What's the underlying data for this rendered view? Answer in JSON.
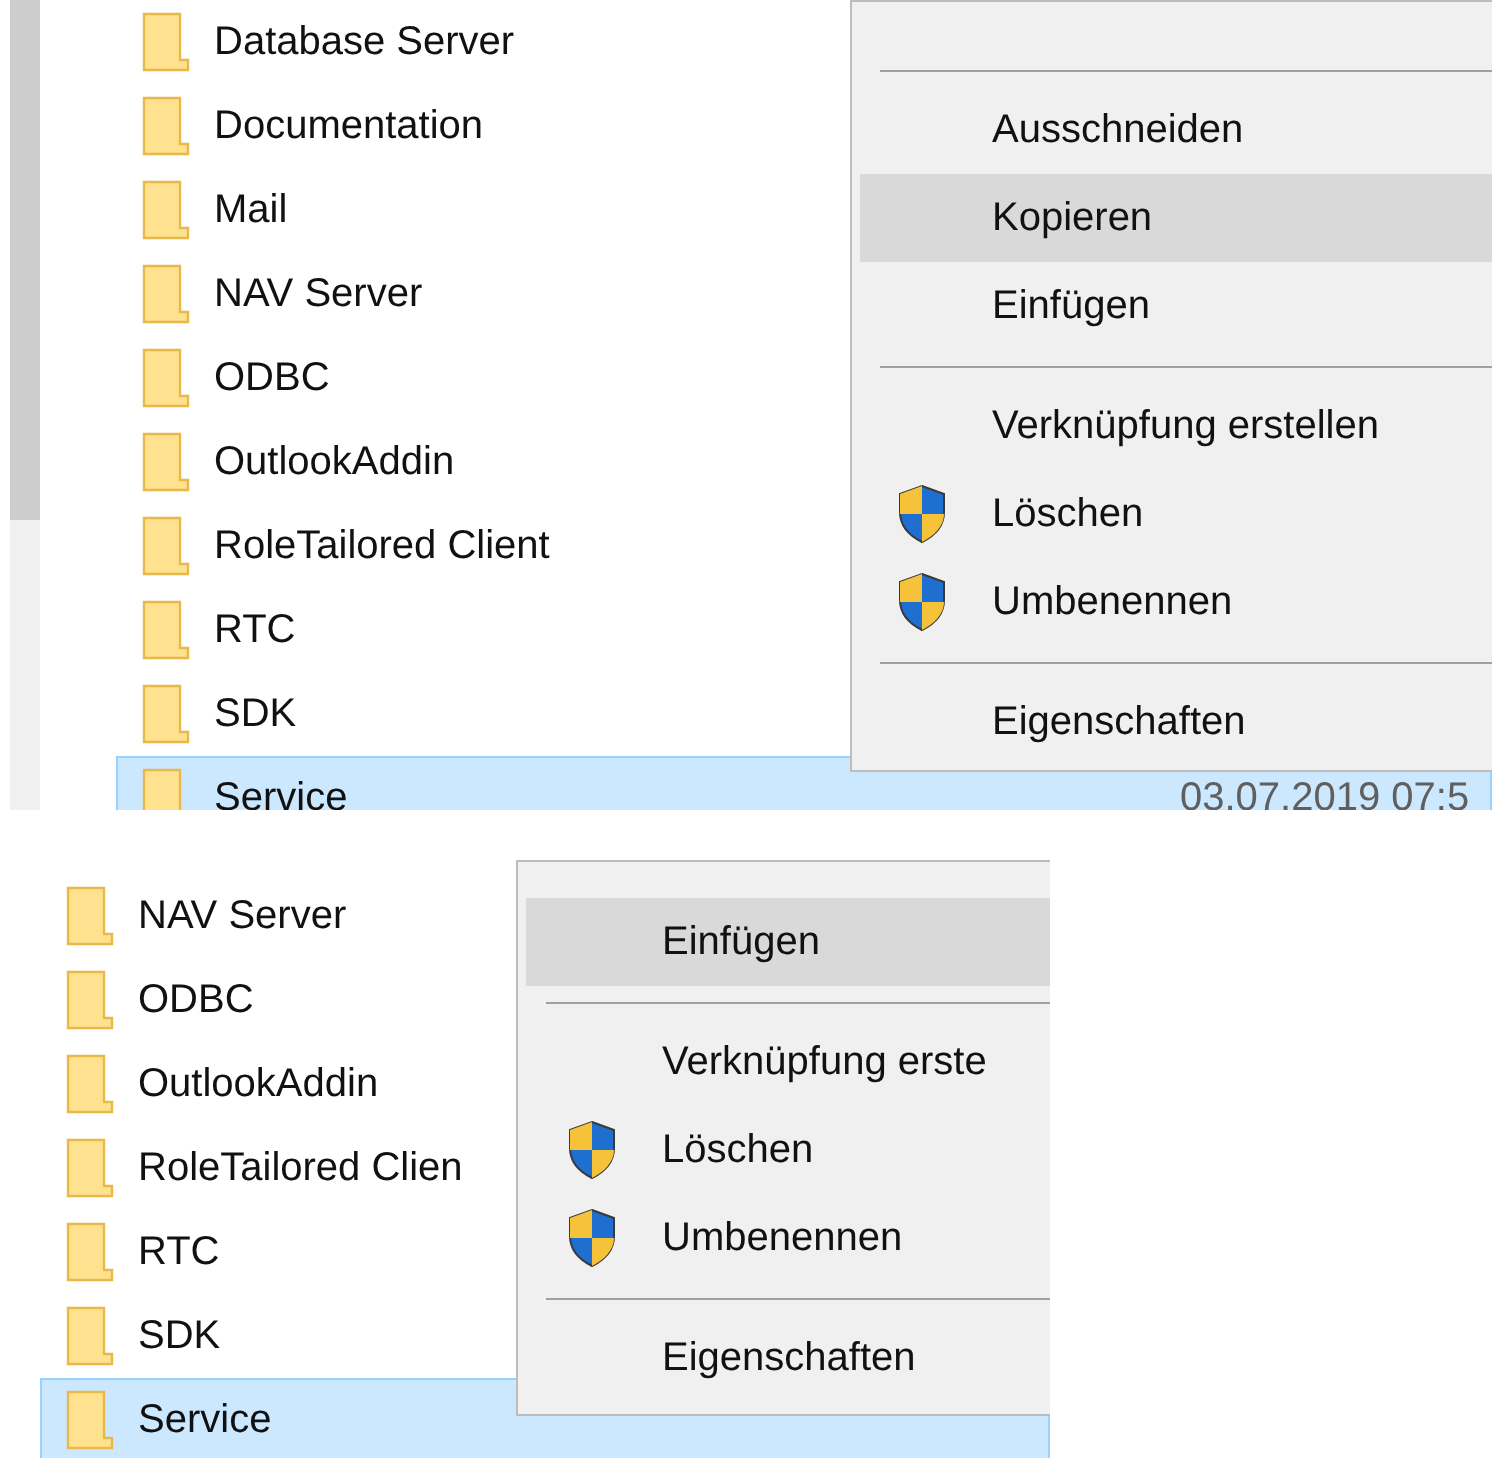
{
  "panels": [
    {
      "rows": [
        {
          "name": "Database Server",
          "selected": false
        },
        {
          "name": "Documentation",
          "selected": false
        },
        {
          "name": "Mail",
          "selected": false
        },
        {
          "name": "NAV Server",
          "selected": false
        },
        {
          "name": "ODBC",
          "selected": false
        },
        {
          "name": "OutlookAddin",
          "selected": false
        },
        {
          "name": "RoleTailored Client",
          "selected": false
        },
        {
          "name": "RTC",
          "selected": false
        },
        {
          "name": "SDK",
          "selected": false
        },
        {
          "name": "Service",
          "selected": true,
          "date": "03.07.2019 07:5"
        }
      ],
      "menu": {
        "items": [
          {
            "kind": "separator"
          },
          {
            "kind": "command",
            "label": "Ausschneiden",
            "selected": false
          },
          {
            "kind": "command",
            "label": "Kopieren",
            "selected": true
          },
          {
            "kind": "command",
            "label": "Einfügen",
            "selected": false
          },
          {
            "kind": "separator"
          },
          {
            "kind": "command",
            "label": "Verknüpfung erstellen",
            "selected": false
          },
          {
            "kind": "protected",
            "label": "Löschen",
            "selected": false
          },
          {
            "kind": "protected",
            "label": "Umbenennen",
            "selected": false
          },
          {
            "kind": "separator"
          },
          {
            "kind": "command",
            "label": "Eigenschaften",
            "selected": false
          }
        ]
      }
    },
    {
      "rows": [
        {
          "name": "NAV Server",
          "selected": false
        },
        {
          "name": "ODBC",
          "selected": false
        },
        {
          "name": "OutlookAddin",
          "selected": false
        },
        {
          "name": "RoleTailored Clien",
          "selected": false
        },
        {
          "name": "RTC",
          "selected": false
        },
        {
          "name": "SDK",
          "selected": false
        },
        {
          "name": "Service",
          "selected": true
        }
      ],
      "menu": {
        "items": [
          {
            "kind": "command",
            "label": "Einfügen",
            "selected": true
          },
          {
            "kind": "separator"
          },
          {
            "kind": "command",
            "label": "Verknüpfung erste",
            "selected": false
          },
          {
            "kind": "protected",
            "label": "Löschen",
            "selected": false
          },
          {
            "kind": "protected",
            "label": "Umbenennen",
            "selected": false
          },
          {
            "kind": "separator"
          },
          {
            "kind": "command",
            "label": "Eigenschaften",
            "selected": false
          }
        ]
      }
    }
  ]
}
